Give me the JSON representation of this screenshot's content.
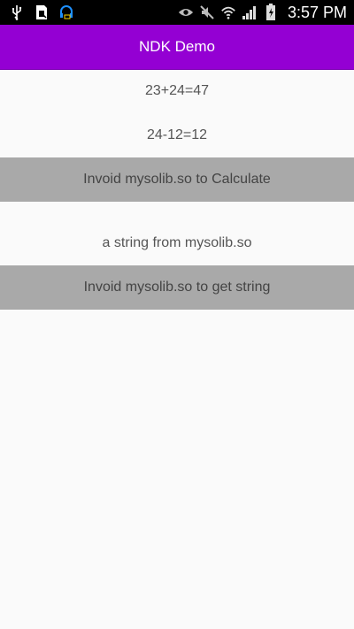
{
  "status_bar": {
    "time": "3:57 PM",
    "left_icons": [
      "usb-icon",
      "sim-card-icon",
      "headset-icon"
    ],
    "right_icons": [
      "eye-icon",
      "mute-icon",
      "wifi-icon",
      "signal-icon",
      "battery-icon"
    ]
  },
  "app_bar": {
    "title": "NDK Demo",
    "color": "#9400d3"
  },
  "main": {
    "result_add": "23+24=47",
    "result_sub": "24-12=12",
    "calc_button_label": "Invoid mysolib.so to Calculate",
    "string_result": "a string from mysolib.so",
    "string_button_label": "Invoid mysolib.so to get string"
  }
}
